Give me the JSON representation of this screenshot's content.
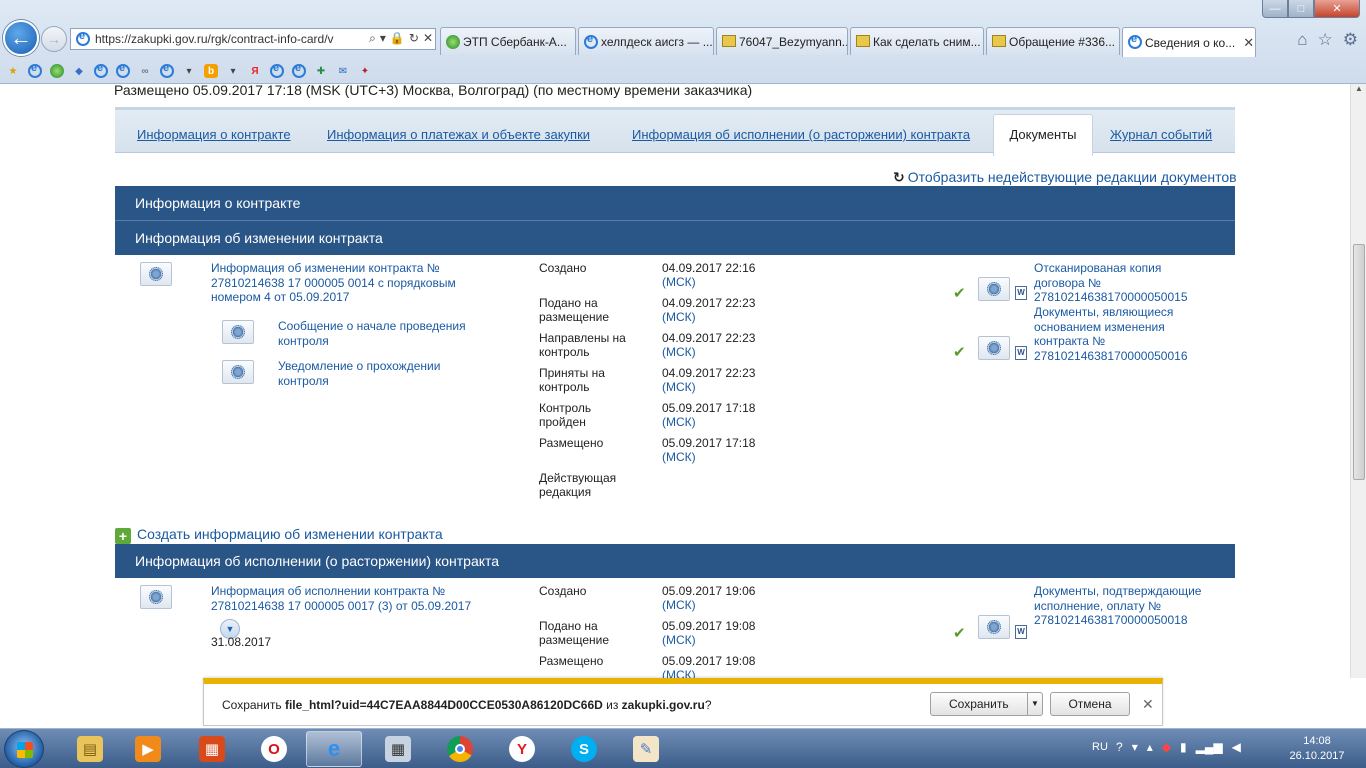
{
  "browser": {
    "address": "https://zakupki.gov.ru/rgk/contract-info-card/v",
    "tabs": [
      {
        "label": "ЭТП Сбербанк-А..."
      },
      {
        "label": "хелпдеск аисгз — ..."
      },
      {
        "label": "76047_Bezymyann..."
      },
      {
        "label": "Как сделать сним..."
      },
      {
        "label": "Обращение #336..."
      },
      {
        "label": "Сведения о ко..."
      }
    ],
    "window_controls": {
      "minimize": "—",
      "maximize": "□",
      "close": "✕"
    },
    "nav_icons": {
      "home": "⌂",
      "favorites": "☆",
      "tools": "⚙"
    }
  },
  "page": {
    "posted_line": "Размещено 05.09.2017 17:18 (MSK (UTC+3) Москва, Волгоград) (по местному времени заказчика)",
    "tabs": [
      {
        "label": "Информация о контракте"
      },
      {
        "label": "Информация о платежах и объекте закупки"
      },
      {
        "label": "Информация об исполнении (о расторжении) контракта"
      },
      {
        "label": "Документы",
        "active": true
      },
      {
        "label": "Журнал событий"
      }
    ],
    "show_inactive": "Отобразить недействующие редакции документов",
    "sections": {
      "contract_info": "Информация о контракте",
      "change_info": "Информация об изменении контракта",
      "execution_info": "Информация об исполнении (о расторжении) контракта"
    },
    "change_block": {
      "title": "Информация об изменении контракта № 27810214638 17 000005 0014 с порядковым номером 4 от 05.09.2017",
      "sub_docs": [
        "Сообщение о начале проведения контроля",
        "Уведомление о прохождении контроля"
      ],
      "statuses": [
        {
          "label": "Создано",
          "date": "04.09.2017 22:16",
          "tz": "(МСК)"
        },
        {
          "label": "Подано на размещение",
          "date": "04.09.2017 22:23",
          "tz": "(МСК)"
        },
        {
          "label": "Направлены на контроль",
          "date": "04.09.2017 22:23",
          "tz": "(МСК)"
        },
        {
          "label": "Приняты на контроль",
          "date": "04.09.2017 22:23",
          "tz": "(МСК)"
        },
        {
          "label": "Контроль пройден",
          "date": "05.09.2017 17:18",
          "tz": "(МСК)"
        },
        {
          "label": "Размещено",
          "date": "05.09.2017 17:18",
          "tz": "(МСК)"
        },
        {
          "label": "Действующая редакция",
          "date": "",
          "tz": ""
        }
      ],
      "attachments": [
        "Отсканированая копия договора № 27810214638170000050015",
        "Документы, являющиеся основанием изменения контракта № 27810214638170000050016"
      ]
    },
    "create_link": "Создать информацию об изменении контракта",
    "execution_block": {
      "title": "Информация об исполнении контракта № 27810214638 17 000005 0017 (3) от 05.09.2017",
      "date_below": "31.08.2017",
      "statuses": [
        {
          "label": "Создано",
          "date": "05.09.2017 19:06",
          "tz": "(МСК)"
        },
        {
          "label": "Подано на размещение",
          "date": "05.09.2017 19:08",
          "tz": "(МСК)"
        },
        {
          "label": "Размещено",
          "date": "05.09.2017 19:08",
          "tz": "(МСК)"
        }
      ],
      "attachments": [
        "Документы, подтверждающие исполнение, оплату № 27810214638170000050018"
      ]
    }
  },
  "download_bar": {
    "prefix": "Сохранить ",
    "filename": "file_html?uid=44C7EAA8844D00CCE0530A86120DC66D",
    "middle": " из ",
    "site": "zakupki.gov.ru",
    "suffix": "?",
    "save": "Сохранить",
    "cancel": "Отмена"
  },
  "taskbar": {
    "lang": "RU",
    "time": "14:08",
    "date": "26.10.2017"
  },
  "colors": {
    "section_header": "#2a5587",
    "link": "#1b5aa3",
    "download_accent": "#e8b300"
  }
}
